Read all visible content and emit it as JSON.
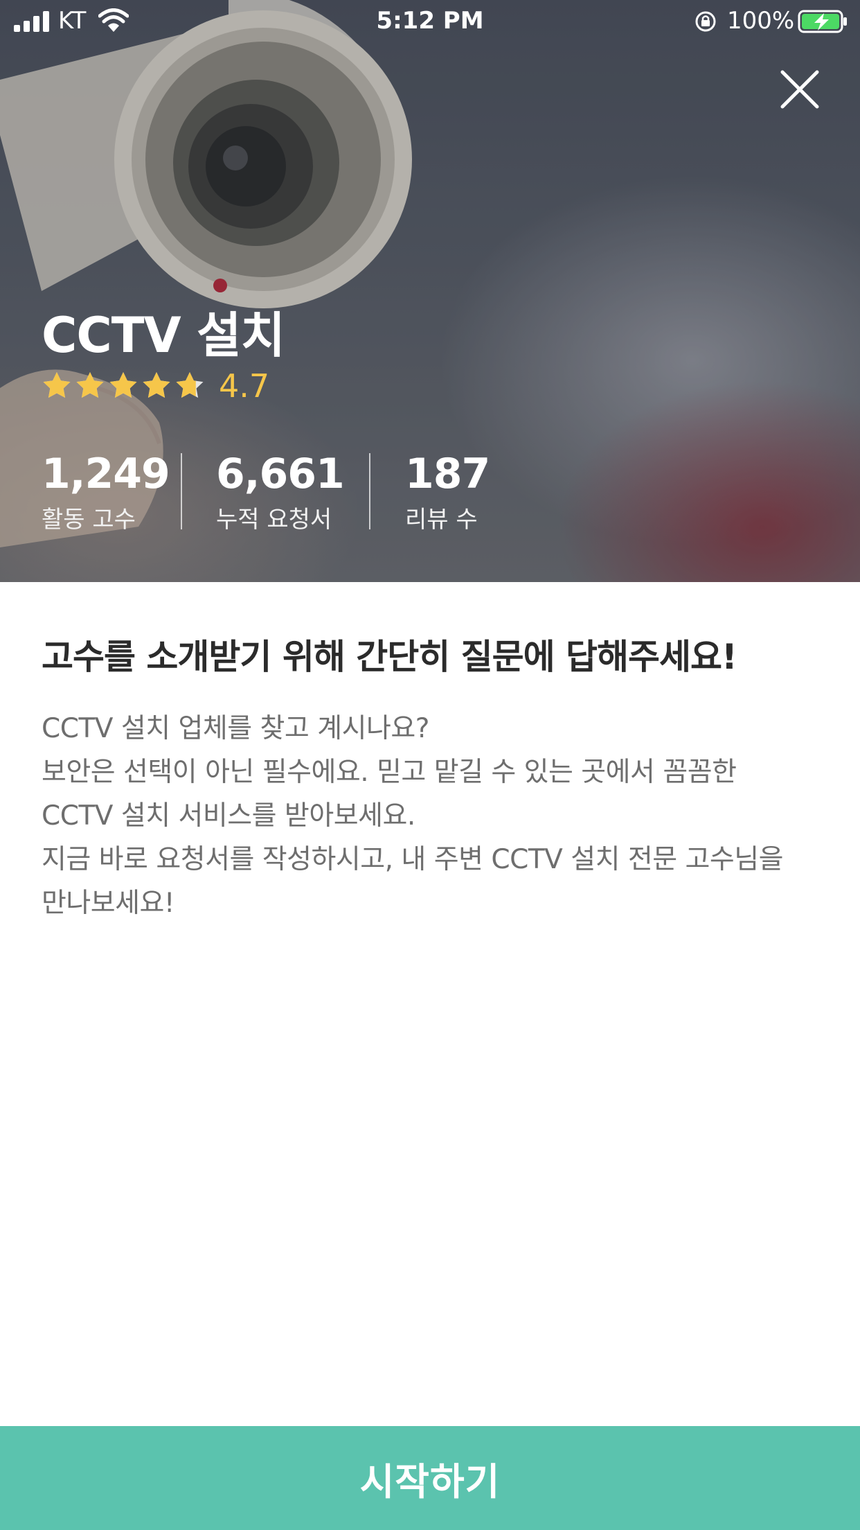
{
  "status_bar": {
    "carrier": "KT",
    "time": "5:12 PM",
    "battery_percent": "100%",
    "icons": [
      "signal-icon",
      "wifi-icon",
      "rotation-lock-icon",
      "battery-charging-icon"
    ]
  },
  "header": {
    "close_icon": "close-icon"
  },
  "service": {
    "title": "CCTV 설치",
    "rating": 4.7,
    "rating_text": "4.7",
    "rating_max": 5,
    "star_color": "#f6c64a",
    "stats": [
      {
        "value": "1,249",
        "label": "활동 고수"
      },
      {
        "value": "6,661",
        "label": "누적 요청서"
      },
      {
        "value": "187",
        "label": "리뷰 수"
      }
    ]
  },
  "content": {
    "heading": "고수를 소개받기 위해 간단히 질문에 답해주세요!",
    "description_lines": [
      "CCTV 설치 업체를 찾고 계시나요?",
      "보안은 선택이 아닌 필수에요. 믿고 맡길 수 있는 곳에서 꼼꼼한",
      "CCTV 설치 서비스를 받아보세요.",
      "지금 바로 요청서를 작성하시고, 내 주변 CCTV 설치 전문 고수님을",
      "만나보세요!"
    ]
  },
  "footer": {
    "start_label": "시작하기",
    "accent_color": "#5bc3ae"
  }
}
